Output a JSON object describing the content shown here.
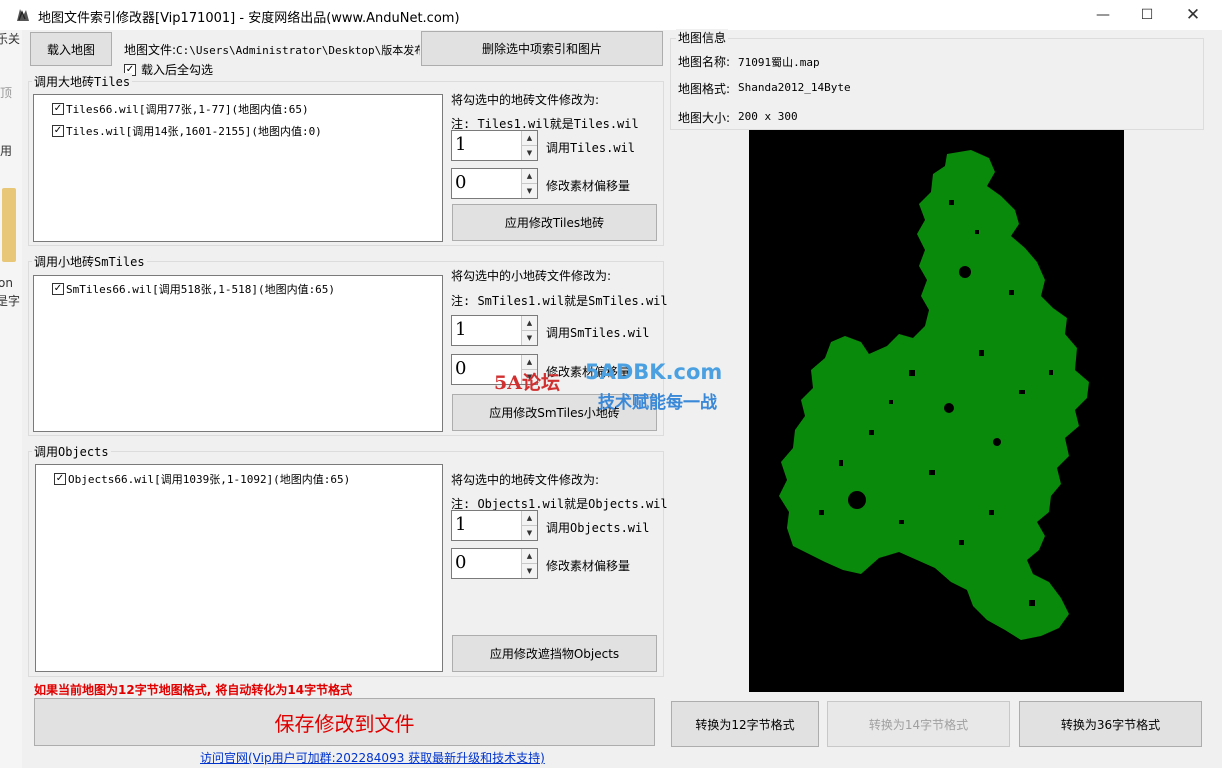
{
  "window": {
    "title": "地图文件索引修改器[Vip171001] - 安度网络出品(www.AnduNet.com)"
  },
  "edge_fragments": [
    "乐关",
    "顶",
    "用",
    "on",
    "是字"
  ],
  "toolbar": {
    "load_map_label": "载入地图",
    "map_file_label": "地图文件:",
    "map_file_path": "C:\\Users\\Administrator\\Desktop\\版本发布\\",
    "auto_check_label": "载入后全勾选",
    "delete_label": "删除选中项索引和图片"
  },
  "tiles_section": {
    "group_label": "调用大地砖Tiles",
    "items": [
      {
        "label": "Tiles66.wil[调用77张,1-77](地图内值:65)",
        "checked": true
      },
      {
        "label": "Tiles.wil[调用14张,1601-2155](地图内值:0)",
        "checked": true
      }
    ],
    "modify_label": "将勾选中的地砖文件修改为:",
    "note": "注: Tiles1.wil就是Tiles.wil",
    "spin1_value": "1",
    "spin1_label": "调用Tiles.wil",
    "spin2_value": "0",
    "spin2_label": "修改素材偏移量",
    "apply_label": "应用修改Tiles地砖"
  },
  "smtiles_section": {
    "group_label": "调用小地砖SmTiles",
    "items": [
      {
        "label": "SmTiles66.wil[调用518张,1-518](地图内值:65)",
        "checked": true
      }
    ],
    "modify_label": "将勾选中的小地砖文件修改为:",
    "note": "注: SmTiles1.wil就是SmTiles.wil",
    "spin1_value": "1",
    "spin1_label": "调用SmTiles.wil",
    "spin2_value": "0",
    "spin2_label": "修改素材偏移量",
    "apply_label": "应用修改SmTiles小地砖"
  },
  "objects_section": {
    "group_label": "调用Objects",
    "items": [
      {
        "label": "Objects66.wil[调用1039张,1-1092](地图内值:65)",
        "checked": true
      }
    ],
    "modify_label": "将勾选中的地砖文件修改为:",
    "note": "注: Objects1.wil就是Objects.wil",
    "spin1_value": "1",
    "spin1_label": "调用Objects.wil",
    "spin2_value": "0",
    "spin2_label": "修改素材偏移量",
    "apply_label": "应用修改遮挡物Objects"
  },
  "footer": {
    "warning": "如果当前地图为12字节地图格式, 将自动转化为14字节格式",
    "save_label": "保存修改到文件",
    "link": "访问官网(Vip用户可加群:202284093 获取最新升级和技术支持)"
  },
  "map_info": {
    "group_label": "地图信息",
    "name_label": "地图名称:",
    "name_value": "71091蜀山.map",
    "format_label": "地图格式:",
    "format_value": "Shanda2012_14Byte",
    "size_label": "地图大小:",
    "size_value": "200 x 300"
  },
  "convert": {
    "to12_label": "转换为12字节格式",
    "to14_label": "转换为14字节格式",
    "to36_label": "转换为36字节格式"
  },
  "watermark": {
    "logo": "5A论坛",
    "site": "5ADBK.com",
    "slogan": "技术赋能每一战"
  },
  "colors": {
    "map_green": "#0a8a0a",
    "map_bg": "#000000",
    "warning_red": "#e00000",
    "link_blue": "#0033cc"
  }
}
